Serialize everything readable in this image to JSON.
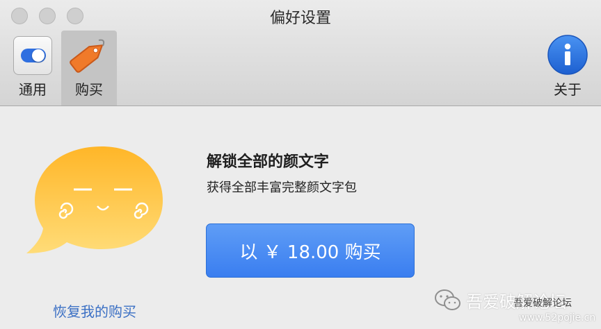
{
  "window": {
    "title": "偏好设置"
  },
  "toolbar": {
    "items": [
      {
        "label": "通用",
        "icon": "toggle-switch-icon"
      },
      {
        "label": "购买",
        "icon": "price-tag-icon",
        "selected": true
      },
      {
        "label": "关于",
        "icon": "info-icon"
      }
    ]
  },
  "purchase": {
    "heading": "解锁全部的颜文字",
    "subheading": "获得全部丰富完整颜文字包",
    "buy_button_label": "以 ￥ 18.00 购买",
    "restore_link": "恢复我的购买"
  },
  "watermark": {
    "name": "吾爱破解论坛",
    "name_small": "吾爱破解论坛",
    "url": "www.52pojie.cn"
  },
  "colors": {
    "accent": "#3a7ef0",
    "link": "#3a6fc4",
    "tag": "#f07a2a",
    "bubble": "#ffc23a"
  }
}
